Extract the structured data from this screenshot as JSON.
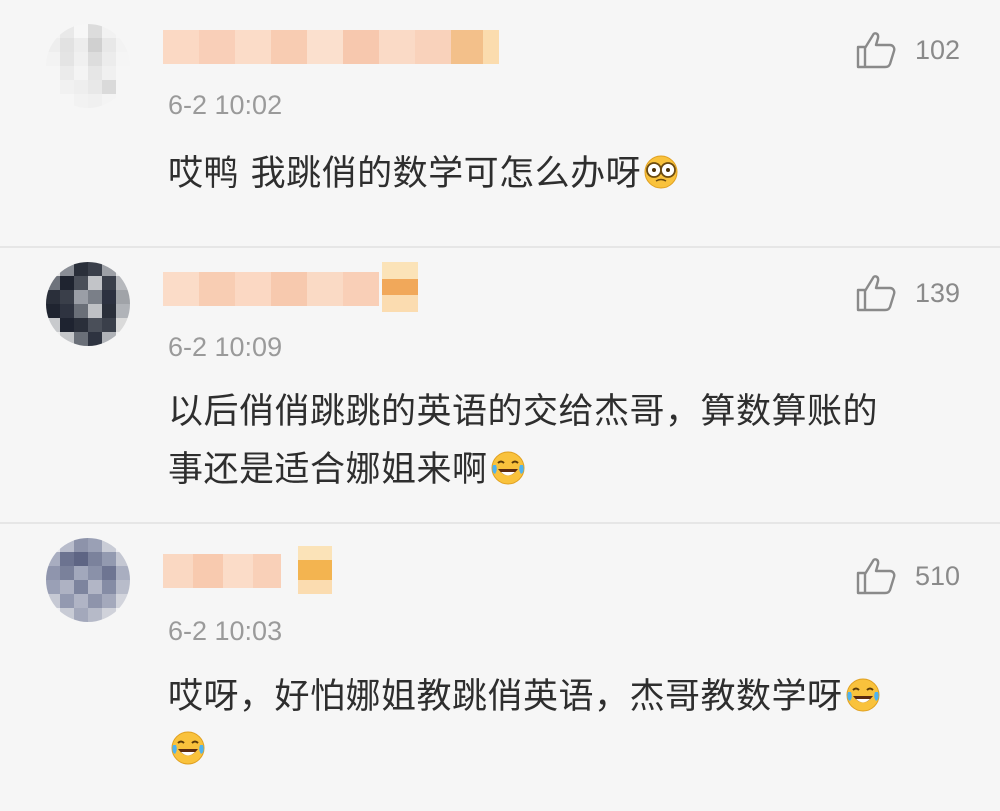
{
  "comments": [
    {
      "likes": "102",
      "time": "6-2 10:02",
      "text": "哎鸭 我跳俏的数学可怎么办呀",
      "emoji": "nervous-glasses-emoji"
    },
    {
      "likes": "139",
      "time": "6-2 10:09",
      "text_line1": "以后俏俏跳跳的英语的交给杰哥，算数算账的",
      "text_line2": "事还是适合娜姐来啊",
      "emoji": "laughing-crying-emoji"
    },
    {
      "likes": "510",
      "time": "6-2 10:03",
      "text": "哎呀，好怕娜姐教跳俏英语，杰哥教数学呀",
      "emoji": "laughing-crying-emoji"
    }
  ]
}
